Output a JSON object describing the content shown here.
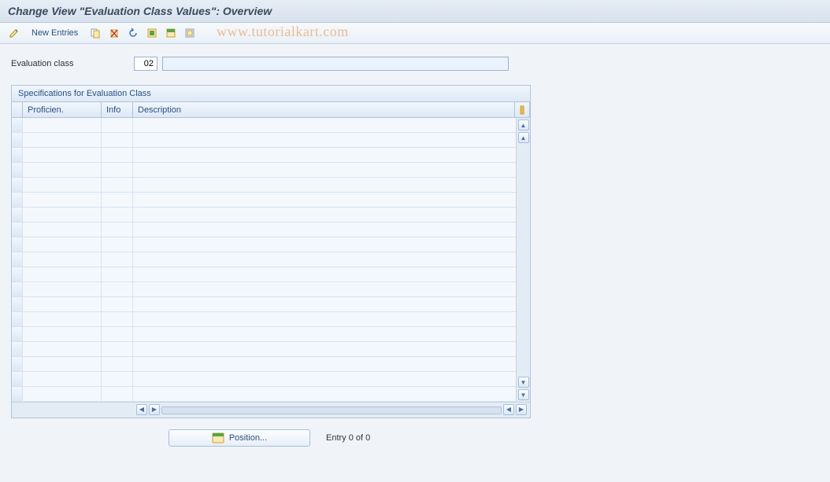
{
  "title": "Change View \"Evaluation Class Values\": Overview",
  "watermark": "www.tutorialkart.com",
  "toolbar": {
    "new_entries_label": "New Entries"
  },
  "fields": {
    "eval_class_label": "Evaluation class",
    "eval_class_value": "02",
    "eval_class_desc": ""
  },
  "panel": {
    "title": "Specifications for Evaluation Class",
    "columns": {
      "c1": "Proficien.",
      "c2": "Info",
      "c3": "Description"
    },
    "row_count": 19
  },
  "footer": {
    "position_label": "Position...",
    "entry_text": "Entry 0 of 0"
  }
}
